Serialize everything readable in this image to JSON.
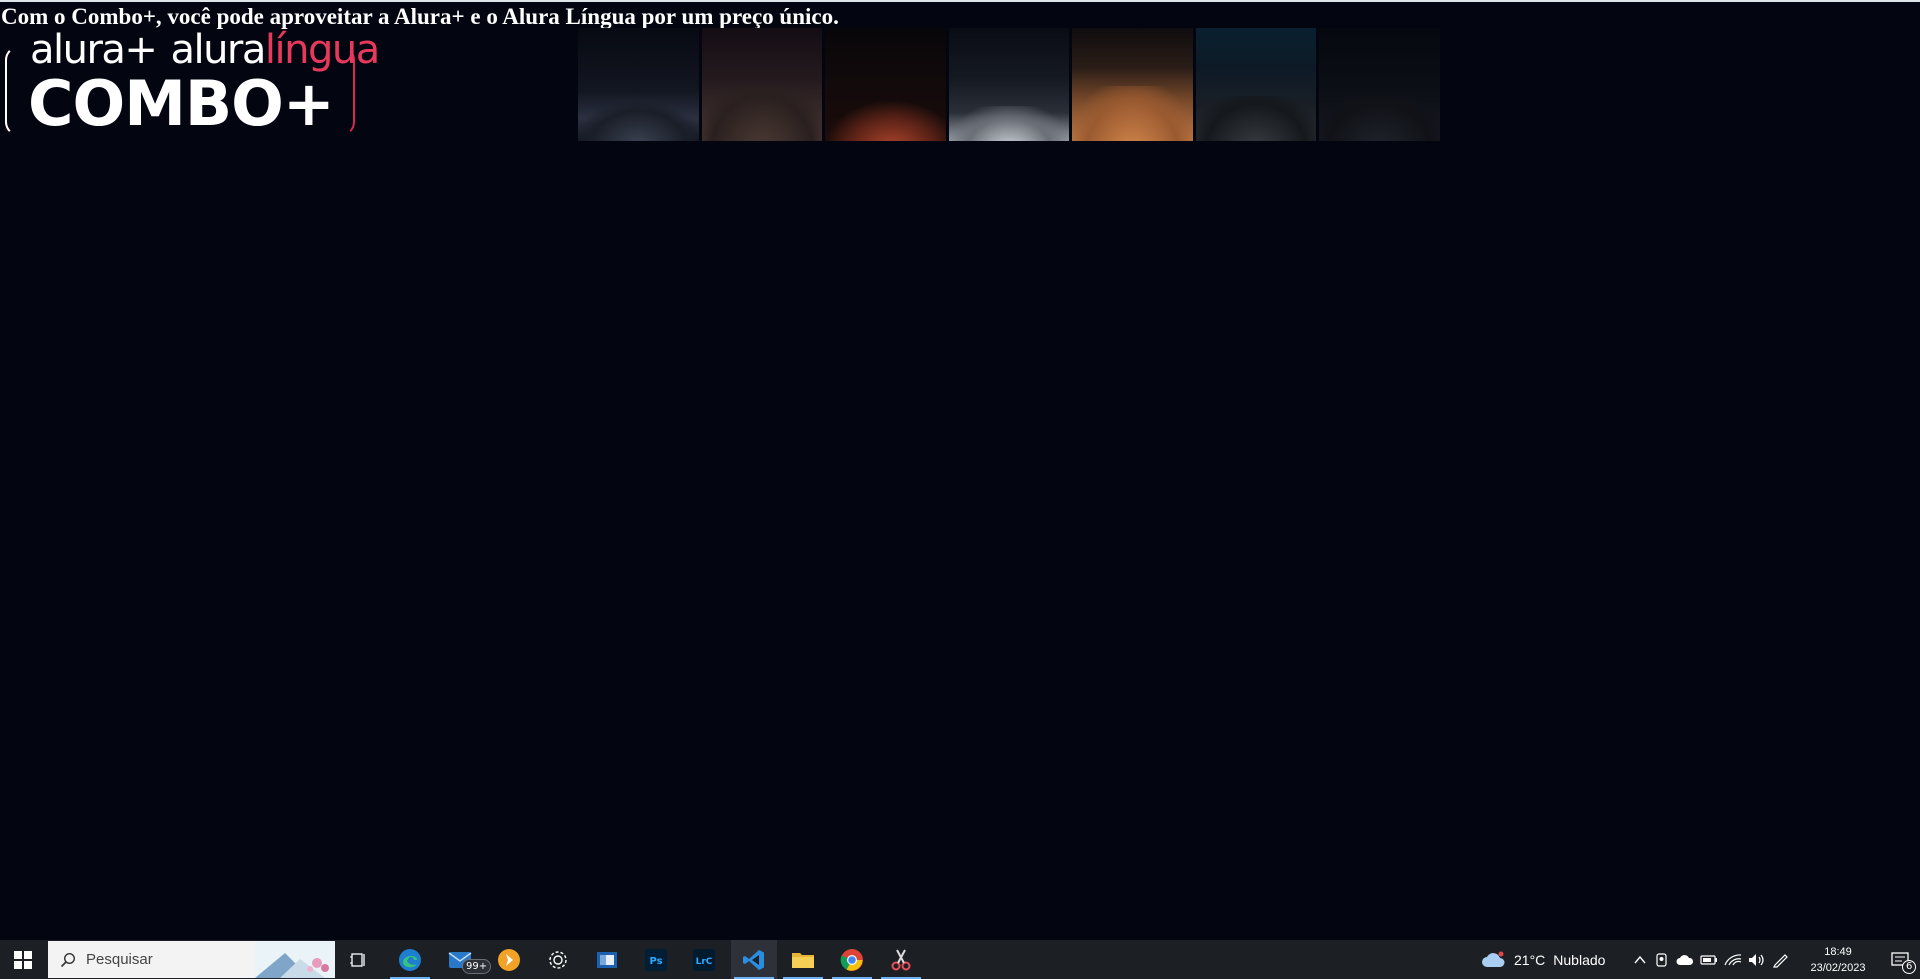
{
  "page": {
    "headline": "Com o Combo+, você pode aproveitar a Alura+ e o Alura Língua por um preço único.",
    "logo": {
      "brand_a": "alura+",
      "brand_b": "alura",
      "brand_b_accent": "língua",
      "combo": "COMBO+"
    },
    "faces_image": "banner-portraits"
  },
  "colors": {
    "background": "#030611",
    "accent_red": "#e8385c",
    "taskbar": "#1c1f24"
  },
  "taskbar": {
    "start_icon": "windows-icon",
    "search_placeholder": "Pesquisar",
    "apps": [
      {
        "name": "task-view-icon"
      },
      {
        "name": "edge-icon"
      },
      {
        "name": "mail-icon",
        "badge": "99+"
      },
      {
        "name": "plex-icon"
      },
      {
        "name": "settings-icon"
      },
      {
        "name": "news-icon"
      },
      {
        "name": "photoshop-icon",
        "label": "Ps"
      },
      {
        "name": "lightroom-icon",
        "label": "LrC"
      },
      {
        "name": "vscode-icon",
        "active": true
      },
      {
        "name": "file-explorer-icon"
      },
      {
        "name": "chrome-icon"
      },
      {
        "name": "snipping-tool-icon"
      }
    ],
    "weather": {
      "temp": "21°C",
      "condition": "Nublado"
    },
    "clock": {
      "time": "18:49",
      "date": "23/02/2023"
    },
    "notifications": "6"
  }
}
